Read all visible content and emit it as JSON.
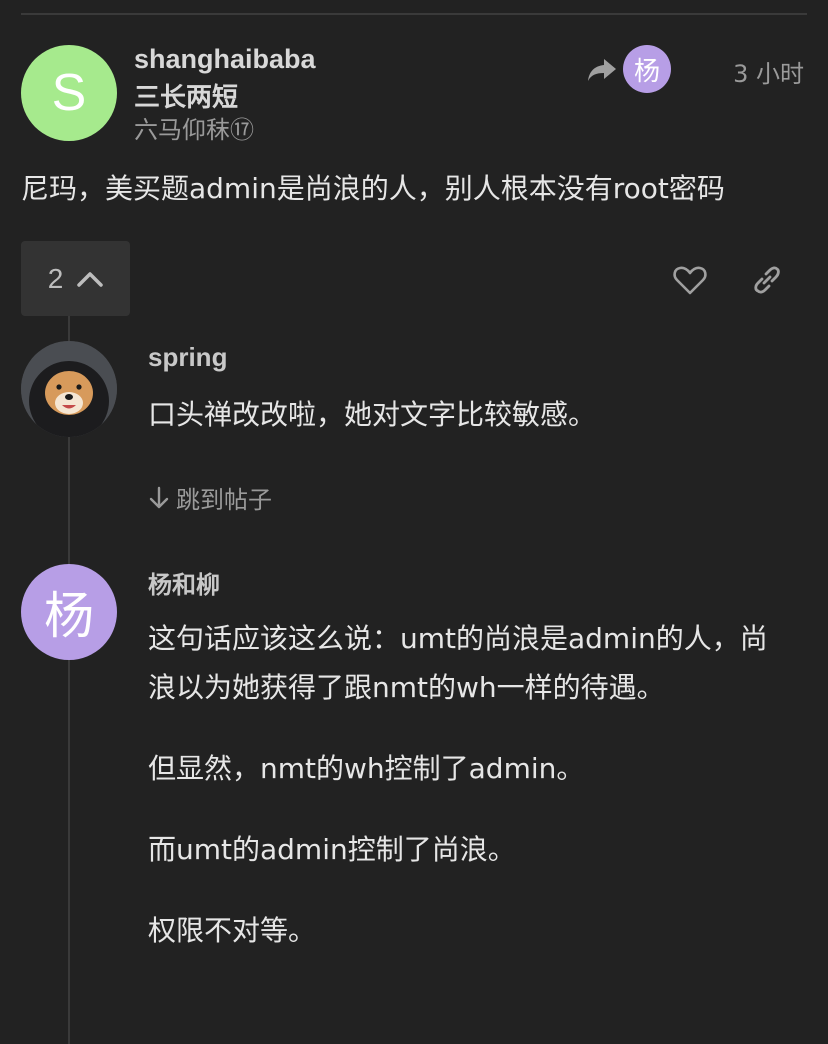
{
  "post": {
    "avatar_letter": "S",
    "avatar_color": "#a6ea8d",
    "username": "shanghaibaba",
    "user_title": "三长两短",
    "user_flair": "六马仰秣⑰",
    "reply_to_avatar": "杨",
    "reply_icon": "share-arrow-icon",
    "time": "3 小时",
    "body": "尼玛，美买题admin是尚浪的人，别人根本没有root密码",
    "replies_count": "2",
    "like_icon": "heart-icon",
    "link_icon": "link-icon"
  },
  "replies": [
    {
      "name": "spring",
      "avatar_icon": "shiba-dog-avatar",
      "body": "口头禅改改啦，她对文字比较敏感。",
      "jump_label": "跳到帖子"
    },
    {
      "name": "杨和柳",
      "avatar_letter": "杨",
      "avatar_color": "#b79ee6",
      "paragraphs": [
        "这句话应该这么说：umt的尚浪是admin的人，尚浪以为她获得了跟nmt的wh一样的待遇。",
        "但显然，nmt的wh控制了admin。",
        "而umt的admin控制了尚浪。",
        "权限不对等。"
      ]
    }
  ],
  "colors": {
    "background": "#222222",
    "text": "#e6e6e6",
    "muted": "#9a9a9a"
  }
}
